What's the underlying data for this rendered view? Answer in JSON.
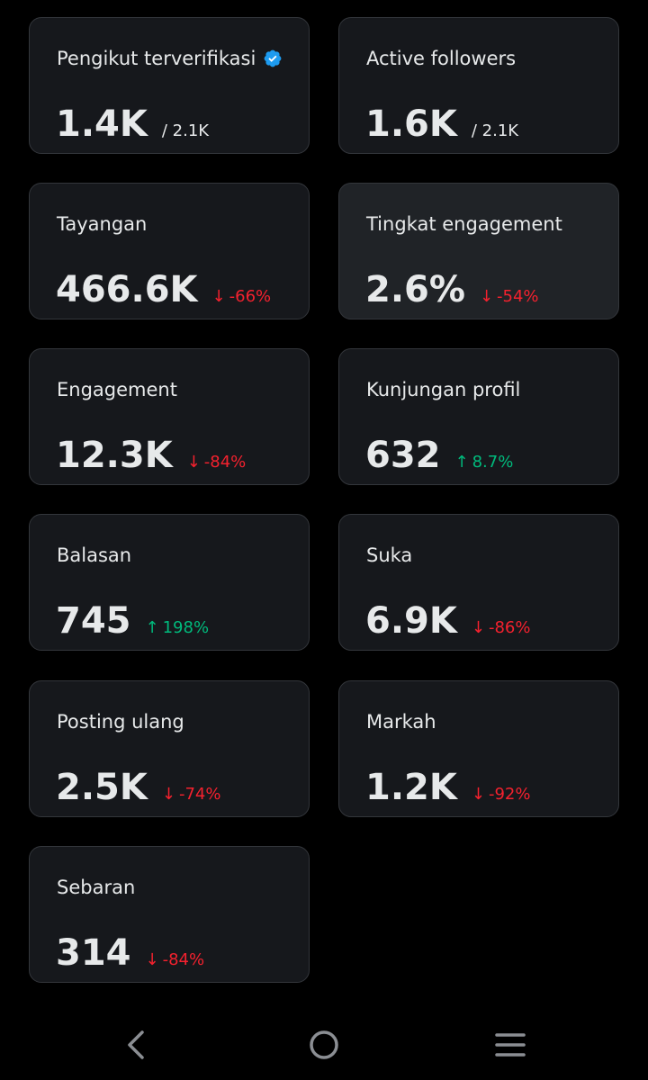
{
  "cards": [
    {
      "title": "Pengikut terverifikasi",
      "value": "1.4K",
      "total": "/ 2.1K",
      "verified_icon": "verified-badge-icon",
      "highlight": false
    },
    {
      "title": "Active followers",
      "value": "1.6K",
      "total": "/ 2.1K",
      "highlight": false
    },
    {
      "title": "Tayangan",
      "value": "466.6K",
      "change": "-66%",
      "direction": "down",
      "highlight": false
    },
    {
      "title": "Tingkat engagement",
      "value": "2.6%",
      "change": "-54%",
      "direction": "down",
      "highlight": true
    },
    {
      "title": "Engagement",
      "value": "12.3K",
      "change": "-84%",
      "direction": "down",
      "highlight": false
    },
    {
      "title": "Kunjungan profil",
      "value": "632",
      "change": "8.7%",
      "direction": "up",
      "highlight": false
    },
    {
      "title": "Balasan",
      "value": "745",
      "change": "198%",
      "direction": "up",
      "highlight": false
    },
    {
      "title": "Suka",
      "value": "6.9K",
      "change": "-86%",
      "direction": "down",
      "highlight": false
    },
    {
      "title": "Posting ulang",
      "value": "2.5K",
      "change": "-74%",
      "direction": "down",
      "highlight": false
    },
    {
      "title": "Markah",
      "value": "1.2K",
      "change": "-92%",
      "direction": "down",
      "highlight": false
    },
    {
      "title": "Sebaran",
      "value": "314",
      "change": "-84%",
      "direction": "down",
      "highlight": false
    }
  ],
  "arrows": {
    "down": "↓",
    "up": "↑"
  },
  "colors": {
    "background": "#000000",
    "card": "#16181c",
    "card_highlight": "#202327",
    "border": "#33363b",
    "text": "#e7e9ea",
    "down": "#f4212e",
    "up": "#00ba7c",
    "verified": "#1d9bf0"
  },
  "navbar": {
    "icons": [
      "back-icon",
      "home-icon",
      "recent-apps-icon"
    ]
  }
}
